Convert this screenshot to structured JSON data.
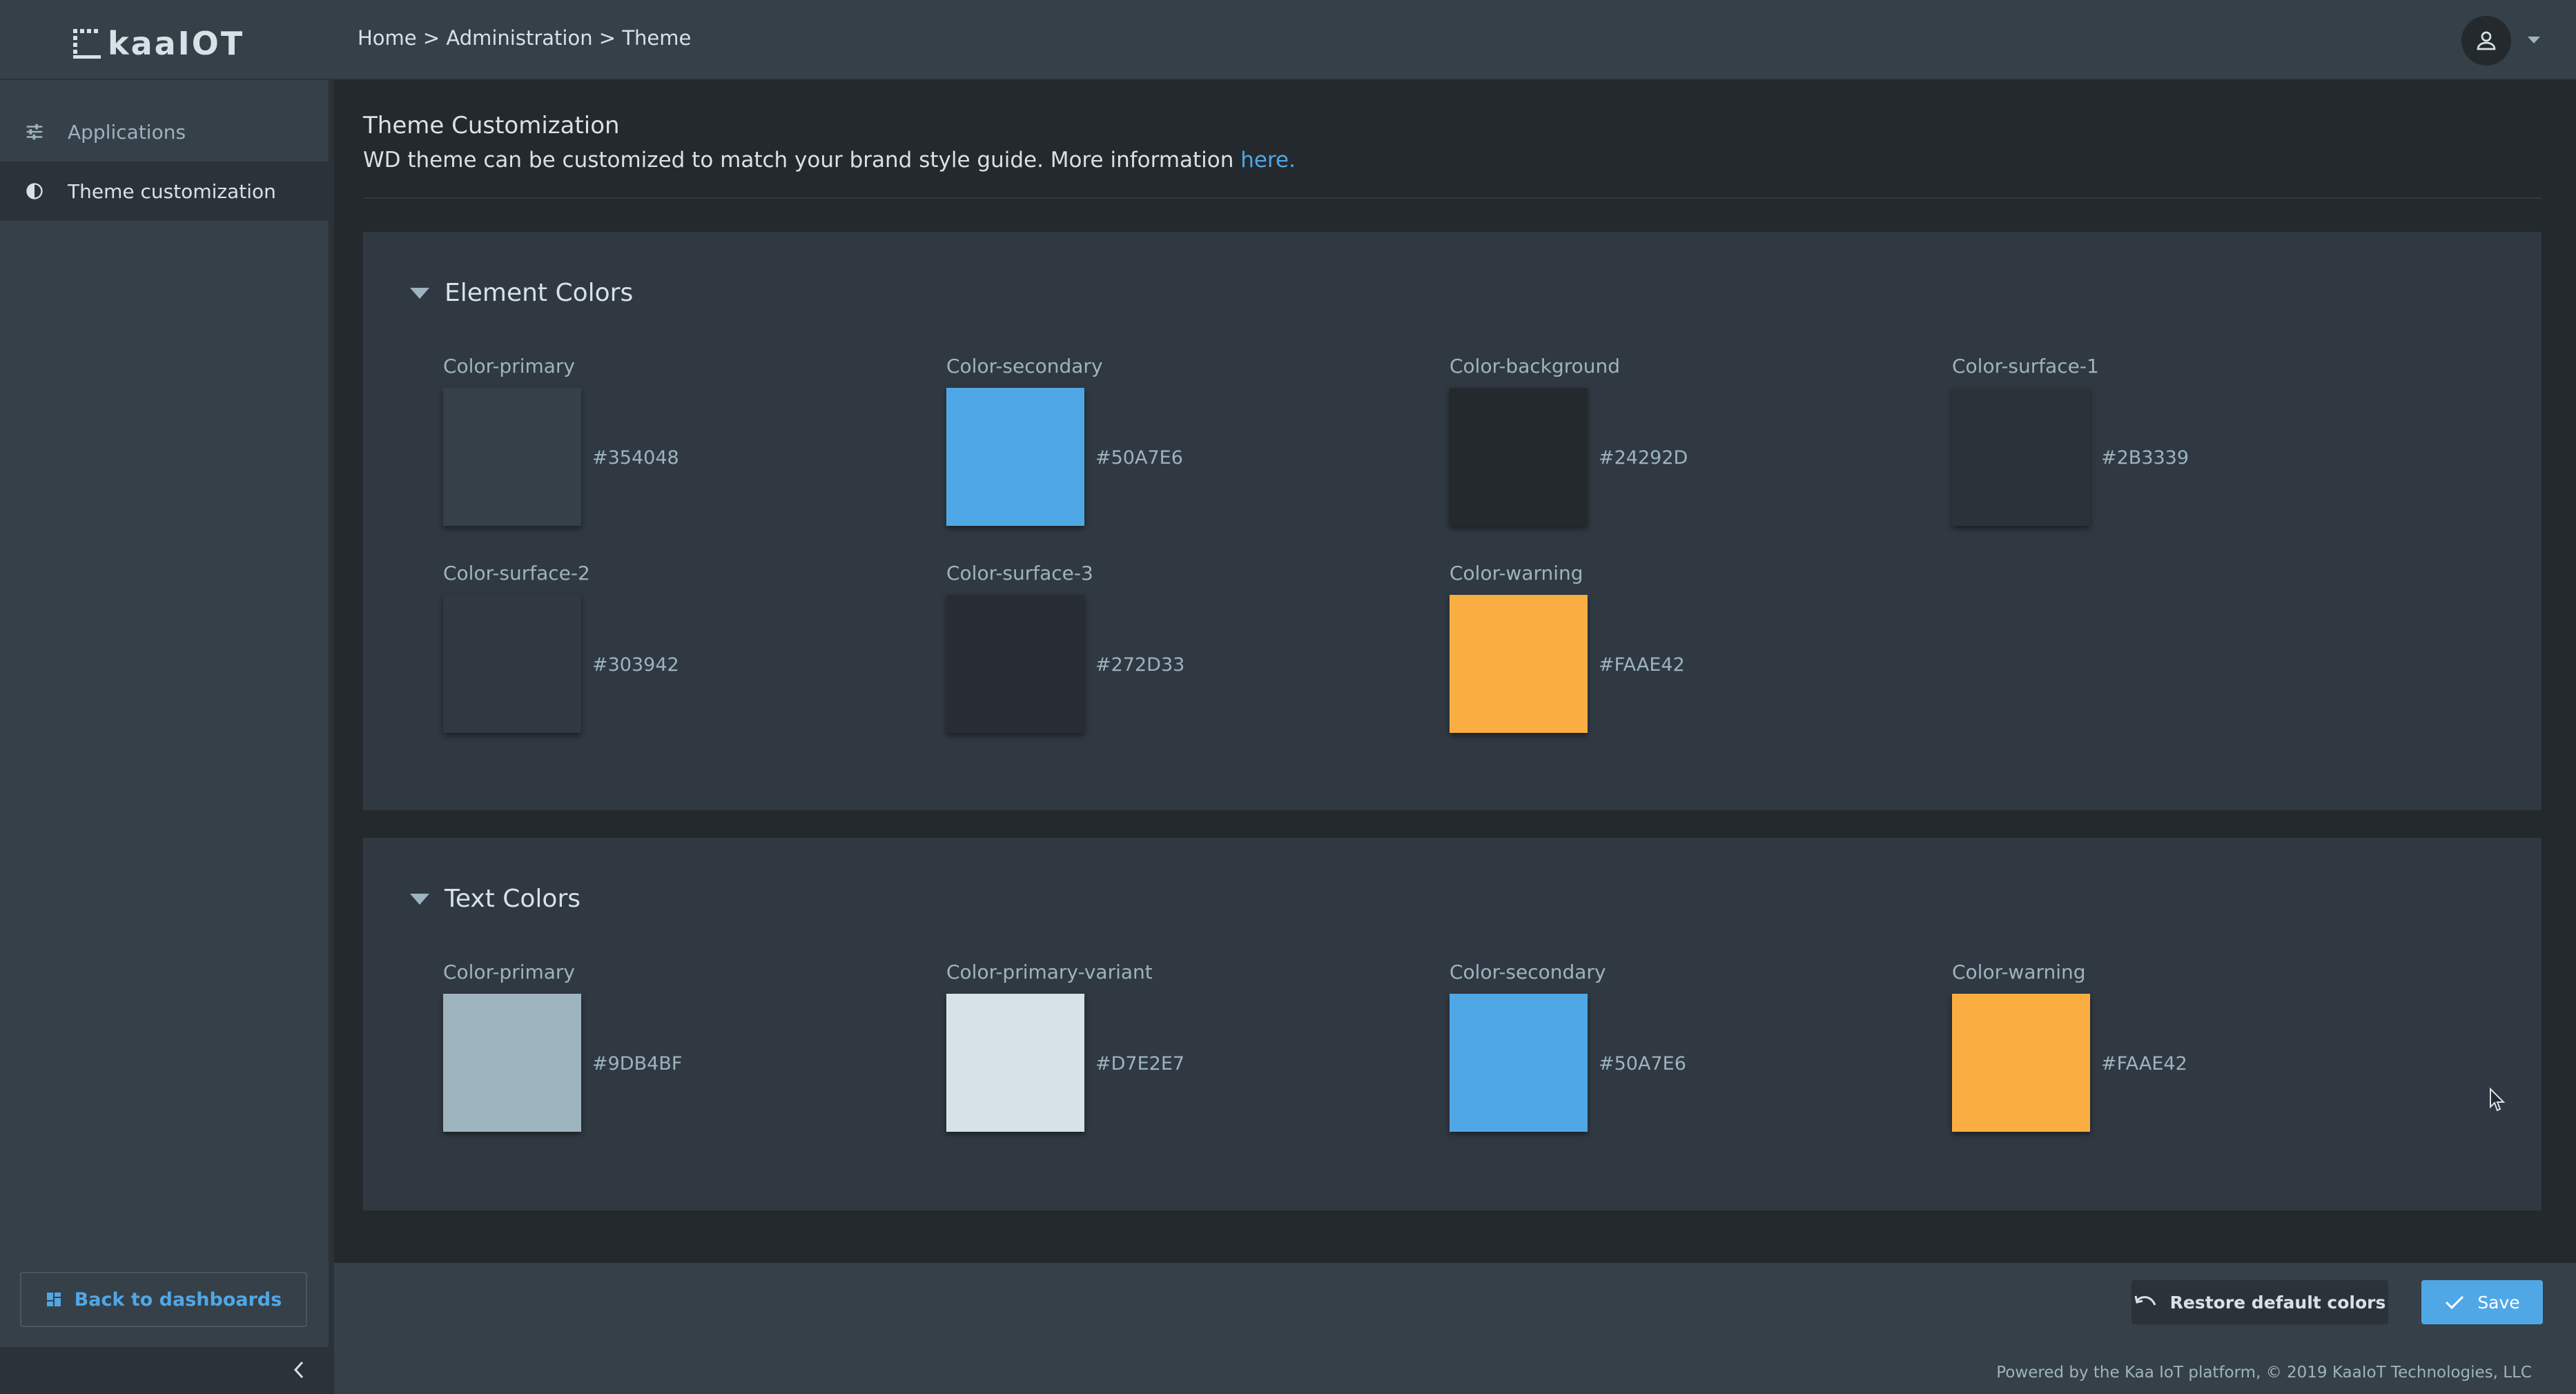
{
  "app": {
    "logo_text": "kaaIOT",
    "breadcrumb": "Home > Administration > Theme"
  },
  "sidebar": {
    "items": [
      {
        "label": "Applications",
        "icon": "sliders-icon",
        "active": false
      },
      {
        "label": "Theme customization",
        "icon": "contrast-icon",
        "active": true
      }
    ],
    "back_label": "Back to dashboards"
  },
  "main": {
    "title": "Theme Customization",
    "subtitle": "WD theme can be customized to match your brand style guide. More information ",
    "subtitle_link": "here",
    "subtitle_end": "."
  },
  "element_colors": {
    "title": "Element Colors",
    "items": [
      {
        "label": "Color-primary",
        "hex": "#354048"
      },
      {
        "label": "Color-secondary",
        "hex": "#50A7E6"
      },
      {
        "label": "Color-background",
        "hex": "#24292D"
      },
      {
        "label": "Color-surface-1",
        "hex": "#2B3339"
      },
      {
        "label": "Color-surface-2",
        "hex": "#303942"
      },
      {
        "label": "Color-surface-3",
        "hex": "#272D33"
      },
      {
        "label": "Color-warning",
        "hex": "#FAAE42"
      }
    ]
  },
  "text_colors": {
    "title": "Text Colors",
    "items": [
      {
        "label": "Color-primary",
        "hex": "#9DB4BF"
      },
      {
        "label": "Color-primary-variant",
        "hex": "#D7E2E7"
      },
      {
        "label": "Color-secondary",
        "hex": "#50A7E6"
      },
      {
        "label": "Color-warning",
        "hex": "#FAAE42"
      }
    ]
  },
  "footer": {
    "restore_label": "Restore default colors",
    "save_label": "Save",
    "powered_by": "Powered by the Kaa IoT platform, © 2019 KaaIoT Technologies, LLC"
  },
  "colors": {
    "accent": "#50A7E6",
    "surface": "#354048",
    "background": "#24292D"
  }
}
